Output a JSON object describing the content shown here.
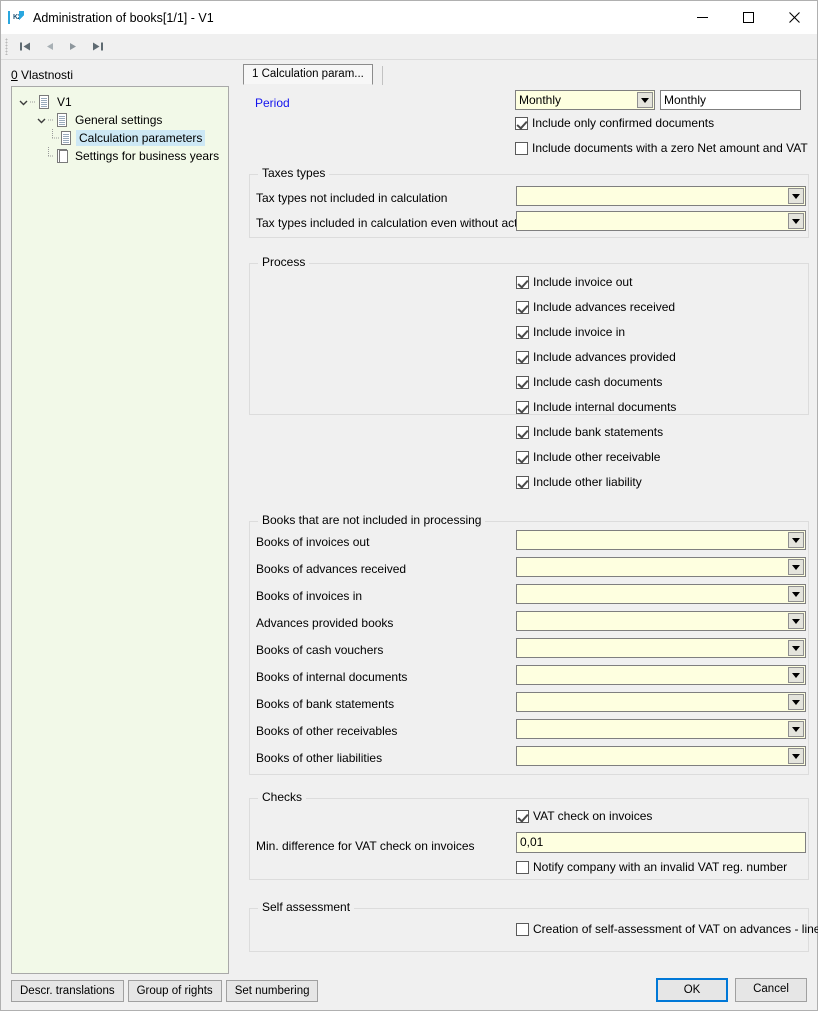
{
  "window": {
    "title": "Administration of books[1/1] - V1",
    "app_icon": "k2-logo-icon",
    "minimize_label": "Minimize",
    "maximize_label": "Maximize",
    "close_label": "Close"
  },
  "navbar": {
    "first_label": "First record",
    "prev_label": "Previous record",
    "next_label": "Next record",
    "last_label": "Last record"
  },
  "left_pane": {
    "header_accel": "0",
    "header_rest": " Vlastnosti",
    "tree": [
      {
        "label": "V1",
        "level": 1,
        "expander": "chevron-down-icon",
        "icon": "document-icon",
        "selected": false
      },
      {
        "label": "General settings",
        "level": 2,
        "expander": "chevron-down-icon",
        "icon": "document-icon",
        "selected": false
      },
      {
        "label": "Calculation parameters",
        "level": 3,
        "expander": "",
        "icon": "document-icon",
        "selected": true
      },
      {
        "label": "Settings for business years",
        "level": 2,
        "expander": "",
        "icon": "documents-icon",
        "selected": false
      }
    ],
    "buttons": [
      {
        "label": "Descr. translations"
      },
      {
        "label": "Group of rights"
      },
      {
        "label": "Set numbering"
      }
    ]
  },
  "tabs": [
    {
      "label": "1 Calculation param...",
      "active": true
    }
  ],
  "form": {
    "period": {
      "label": "Period",
      "combo_value": "Monthly",
      "text_value": "Monthly"
    },
    "top_checks": [
      {
        "label": "Include only confirmed documents",
        "checked": true
      },
      {
        "label": "Include documents with a zero Net amount and VAT",
        "checked": false
      }
    ],
    "taxes_types": {
      "title": "Taxes types",
      "rows": [
        {
          "label": "Tax types not included in calculation",
          "value": ""
        },
        {
          "label": "Tax types included in calculation even without act...",
          "value": ""
        }
      ]
    },
    "process": {
      "title": "Process",
      "items": [
        {
          "label": "Include invoice out",
          "checked": true
        },
        {
          "label": "Include advances received",
          "checked": true
        },
        {
          "label": "Include invoice in",
          "checked": true
        },
        {
          "label": "Include advances provided",
          "checked": true
        },
        {
          "label": "Include cash documents",
          "checked": true
        },
        {
          "label": "Include internal documents",
          "checked": true
        },
        {
          "label": "Include bank statements",
          "checked": true
        },
        {
          "label": "Include other receivable",
          "checked": true
        },
        {
          "label": "Include other liability",
          "checked": true
        }
      ]
    },
    "books_excluded": {
      "title": "Books that are not included in processing",
      "rows": [
        {
          "label": "Books of invoices out",
          "value": ""
        },
        {
          "label": "Books of advances received",
          "value": ""
        },
        {
          "label": "Books of invoices in",
          "value": ""
        },
        {
          "label": "Advances provided books",
          "value": ""
        },
        {
          "label": "Books of cash vouchers",
          "value": ""
        },
        {
          "label": "Books of internal documents",
          "value": ""
        },
        {
          "label": "Books of bank statements",
          "value": ""
        },
        {
          "label": "Books of other receivables",
          "value": ""
        },
        {
          "label": "Books of other liabilities",
          "value": ""
        }
      ]
    },
    "checks": {
      "title": "Checks",
      "vat_check": {
        "label": "VAT check on invoices",
        "checked": true
      },
      "min_diff": {
        "label": "Min. difference for VAT check on invoices",
        "value": "0,01"
      },
      "notify": {
        "label": "Notify company with an invalid VAT reg. number",
        "checked": false
      }
    },
    "self_assessment": {
      "title": "Self assessment",
      "item": {
        "label": "Creation of self-assessment of VAT on advances - lines",
        "checked": false
      }
    }
  },
  "footer": {
    "ok_label": "OK",
    "cancel_label": "Cancel"
  },
  "colors": {
    "window_bg": "#f0f0f0",
    "tree_bg": "#f2f9e8",
    "field_yellow": "#feffe0",
    "selection": "#cde8f5",
    "link_blue": "#1414ee",
    "focus_blue": "#0078d7"
  }
}
